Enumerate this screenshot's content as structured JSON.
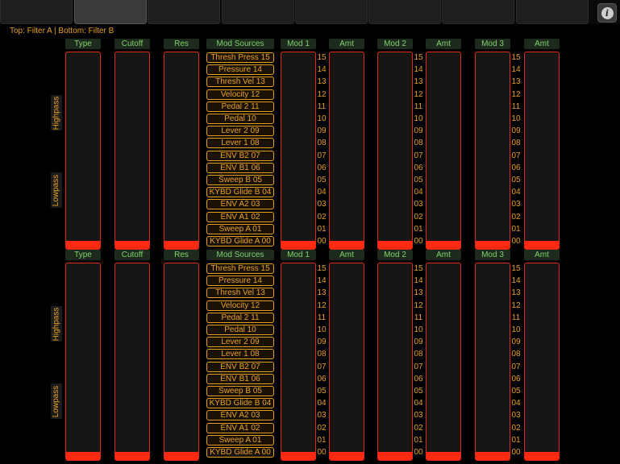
{
  "tabs": [
    {
      "label": "",
      "active": false
    },
    {
      "label": "",
      "active": true
    },
    {
      "label": "",
      "active": false
    },
    {
      "label": "",
      "active": false
    },
    {
      "label": "",
      "active": false
    },
    {
      "label": "",
      "active": false
    },
    {
      "label": "",
      "active": false
    },
    {
      "label": "",
      "active": false
    }
  ],
  "info_icon": "info-icon",
  "info_glyph": "i",
  "subtitle": "Top: Filter A | Bottom: Filter B",
  "colors": {
    "accent": "#e8a020",
    "header_text": "#7ed36a",
    "slider_border": "#e02a1a",
    "slider_fill": "#ff2a10"
  },
  "sections": [
    {
      "headers": {
        "type": "Type",
        "cutoff": "Cutoff",
        "res": "Res",
        "mod_sources": "Mod Sources",
        "mod1": "Mod 1",
        "amt1": "Amt",
        "mod2": "Mod 2",
        "amt2": "Amt",
        "mod3": "Mod 3",
        "amt3": "Amt"
      },
      "type_labels": {
        "top": "Highpass",
        "bottom": "Lowpass"
      },
      "slider_levels": {
        "type": 0.04,
        "cutoff": 0.04,
        "res": 0.04,
        "mod1": 0.04,
        "amt1": 0.04,
        "mod2": 0.04,
        "amt2": 0.04,
        "mod3": 0.04,
        "amt3": 0.04
      },
      "mod_sources": [
        "Thresh Press 15",
        "Pressure 14",
        "Thresh Vel 13",
        "Velocity 12",
        "Pedal 2 11",
        "Pedal 10",
        "Lever 2 09",
        "Lever 1 08",
        "ENV B2 07",
        "ENV B1 06",
        "Sweep B 05",
        "KYBD Glide B 04",
        "ENV A2 03",
        "ENV A1 02",
        "Sweep A 01",
        "KYBD Glide A 00"
      ],
      "mod_numbers": [
        "15",
        "14",
        "13",
        "12",
        "11",
        "10",
        "09",
        "08",
        "07",
        "06",
        "05",
        "04",
        "03",
        "02",
        "01",
        "00"
      ]
    },
    {
      "headers": {
        "type": "Type",
        "cutoff": "Cutoff",
        "res": "Res",
        "mod_sources": "Mod Sources",
        "mod1": "Mod 1",
        "amt1": "Amt",
        "mod2": "Mod 2",
        "amt2": "Amt",
        "mod3": "Mod 3",
        "amt3": "Amt"
      },
      "type_labels": {
        "top": "Highpass",
        "bottom": "Lowpass"
      },
      "slider_levels": {
        "type": 0.04,
        "cutoff": 0.04,
        "res": 0.04,
        "mod1": 0.04,
        "amt1": 0.04,
        "mod2": 0.04,
        "amt2": 0.04,
        "mod3": 0.04,
        "amt3": 0.04
      },
      "mod_sources": [
        "Thresh Press 15",
        "Pressure 14",
        "Thresh Vel 13",
        "Velocity 12",
        "Pedal 2 11",
        "Pedal 10",
        "Lever 2 09",
        "Lever 1 08",
        "ENV B2 07",
        "ENV B1 06",
        "Sweep B 05",
        "KYBD Glide B 04",
        "ENV A2 03",
        "ENV A1 02",
        "Sweep A 01",
        "KYBD Glide A 00"
      ],
      "mod_numbers": [
        "15",
        "14",
        "13",
        "12",
        "11",
        "10",
        "09",
        "08",
        "07",
        "06",
        "05",
        "04",
        "03",
        "02",
        "01",
        "00"
      ]
    }
  ]
}
